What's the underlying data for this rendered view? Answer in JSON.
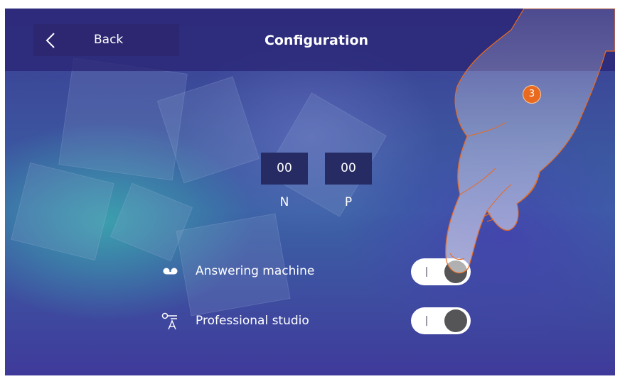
{
  "header": {
    "back_label": "Back",
    "title": "Configuration"
  },
  "code": {
    "n_value": "00",
    "p_value": "00",
    "n_label": "N",
    "p_label": "P"
  },
  "settings": [
    {
      "label": "Answering machine",
      "icon": "answering-machine-icon",
      "enabled": false
    },
    {
      "label": "Professional studio",
      "icon": "professional-studio-icon",
      "enabled": false
    }
  ],
  "callout": {
    "step": "3"
  },
  "colors": {
    "accent": "#e96a1e",
    "topbar": "#2a2676",
    "toggle_knob": "#555558"
  }
}
